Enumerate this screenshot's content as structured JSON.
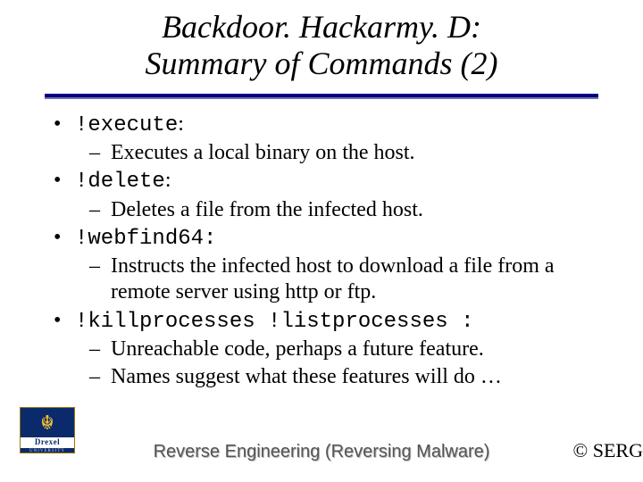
{
  "title_line1": "Backdoor. Hackarmy. D:",
  "title_line2": "Summary of Commands (2)",
  "bullets": [
    {
      "cmd": "!execute",
      "colon": ":",
      "subs": [
        "Executes a local binary on the host."
      ]
    },
    {
      "cmd": "!delete",
      "colon": ":",
      "subs": [
        "Deletes a file from the infected host."
      ]
    },
    {
      "cmd": "!webfind64",
      "colon_mono": ":",
      "subs": [
        "Instructs the infected host to download a file from a remote server using http or ftp."
      ]
    },
    {
      "cmd": "!killprocesses !listprocesses ",
      "colon_mono": ":",
      "subs": [
        "Unreachable code, perhaps a future feature.",
        "Names suggest what these features will do …"
      ]
    }
  ],
  "logo": {
    "name": "Drexel",
    "sub": "UNIVERSITY"
  },
  "footer_center": "Reverse Engineering (Reversing Malware)",
  "footer_right": "© SERG"
}
